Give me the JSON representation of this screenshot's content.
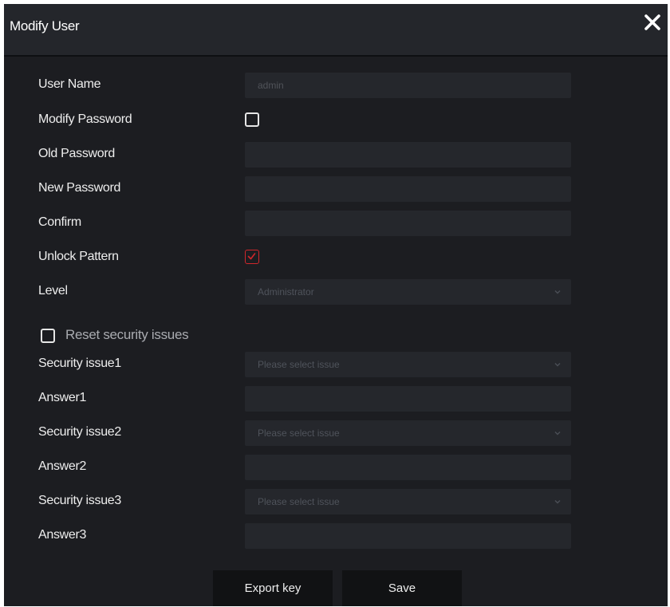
{
  "dialog": {
    "title": "Modify User"
  },
  "fields": {
    "user_name": {
      "label": "User Name",
      "value": "admin"
    },
    "modify_password": {
      "label": "Modify Password",
      "checked": false
    },
    "old_password": {
      "label": "Old Password",
      "value": ""
    },
    "new_password": {
      "label": "New Password",
      "value": ""
    },
    "confirm": {
      "label": "Confirm",
      "value": ""
    },
    "unlock_pattern": {
      "label": "Unlock Pattern",
      "checked": true
    },
    "level": {
      "label": "Level",
      "value": "Administrator"
    }
  },
  "reset_security": {
    "label": "Reset security issues",
    "checked": false
  },
  "security": [
    {
      "issue_label": "Security issue1",
      "issue_placeholder": "Please select issue",
      "answer_label": "Answer1",
      "answer_value": ""
    },
    {
      "issue_label": "Security issue2",
      "issue_placeholder": "Please select issue",
      "answer_label": "Answer2",
      "answer_value": ""
    },
    {
      "issue_label": "Security issue3",
      "issue_placeholder": "Please select issue",
      "answer_label": "Answer3",
      "answer_value": ""
    }
  ],
  "buttons": {
    "export_key": "Export key",
    "save": "Save"
  },
  "icons": {
    "close": "close-icon",
    "chevron": "chevron-down-icon",
    "check": "checkmark-icon"
  },
  "colors": {
    "background": "#1c1d21",
    "titlebar": "#24262b",
    "field": "#25272c",
    "button": "#111214",
    "accent": "#d0272b"
  }
}
